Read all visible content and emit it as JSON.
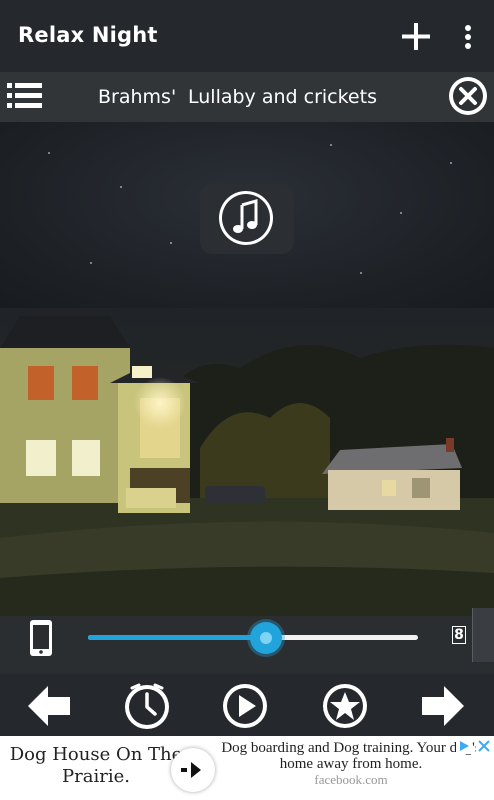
{
  "app": {
    "title": "Relax Night"
  },
  "now_playing": {
    "title_word_1": "Brahms'",
    "title_word_2": "Lullaby and crickets"
  },
  "volume": {
    "level_percent": 54,
    "value": "8"
  },
  "ad": {
    "headline": "Dog House On The Prairie.",
    "body": "Dog boarding and Dog training. Your dog's home away from home.",
    "domain": "facebook.com"
  },
  "colors": {
    "app_bar": "#25282c",
    "accent": "#21a4dc",
    "icon": "#ffffff"
  },
  "icons": {
    "add": "plus-icon",
    "more": "vertical-dots-icon",
    "list": "list-icon",
    "close": "close-circle-icon",
    "music": "music-note-icon",
    "phone": "phone-icon",
    "prev": "arrow-left-icon",
    "timer": "clock-icon",
    "play": "play-icon",
    "favorite": "star-icon",
    "next": "arrow-right-icon"
  }
}
